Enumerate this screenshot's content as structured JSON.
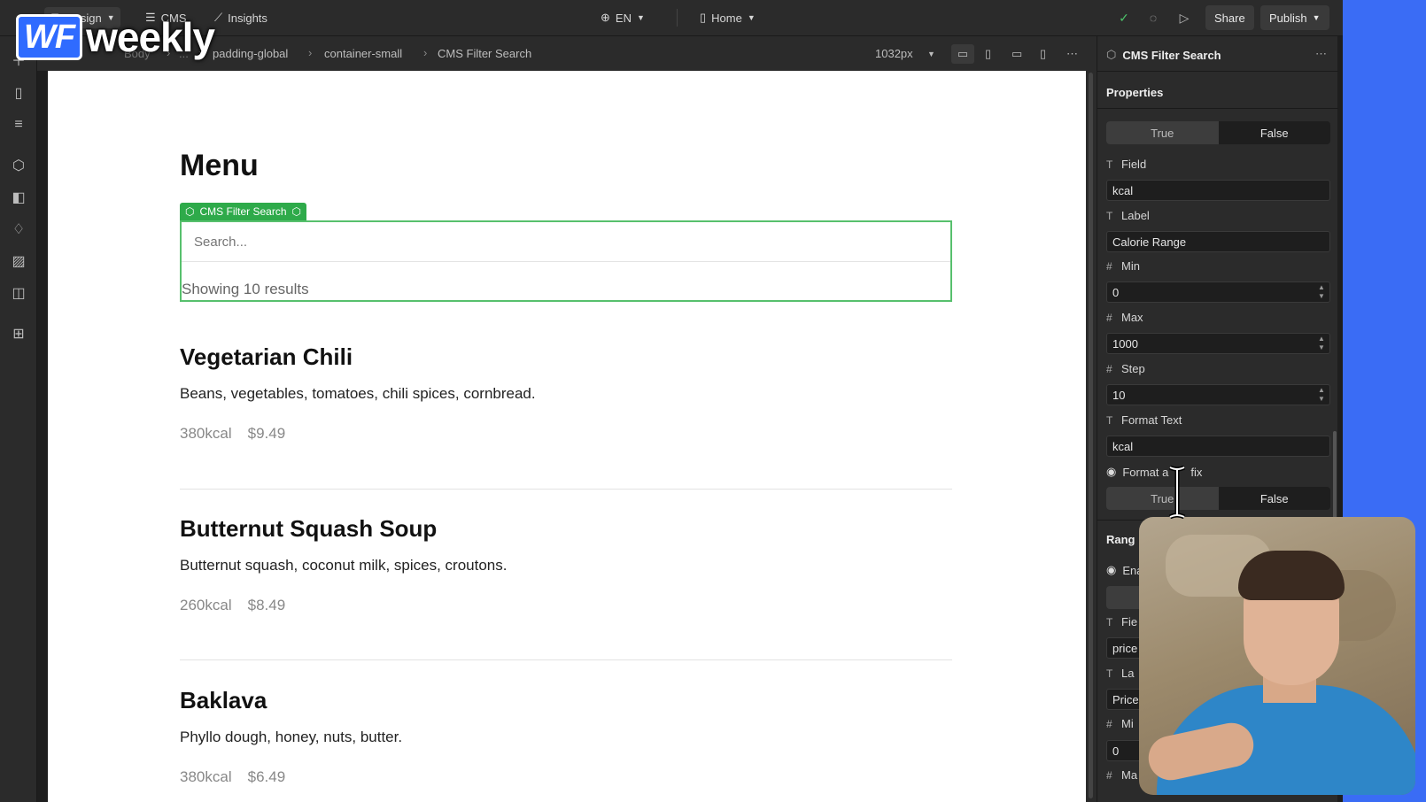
{
  "topbar": {
    "design_label": "Design",
    "cms_label": "CMS",
    "insights_label": "Insights",
    "locale": "EN",
    "page": "Home",
    "share_label": "Share",
    "publish_label": "Publish"
  },
  "logo": {
    "wf": "WF",
    "weekly": "weekly"
  },
  "breadcrumb": {
    "body": "Body",
    "ellipsis": "...",
    "padding": "padding-global",
    "container": "container-small",
    "current": "CMS Filter Search"
  },
  "viewport": {
    "width_label": "1032px"
  },
  "canvas": {
    "title": "Menu",
    "cms_tag": "CMS Filter Search",
    "search_placeholder": "Search...",
    "showing": "Showing 10 results",
    "items": [
      {
        "title": "Vegetarian Chili",
        "desc": "Beans, vegetables, tomatoes, chili spices, cornbread.",
        "kcal": "380kcal",
        "price": "$9.49"
      },
      {
        "title": "Butternut Squash Soup",
        "desc": "Butternut squash, coconut milk, spices, croutons.",
        "kcal": "260kcal",
        "price": "$8.49"
      },
      {
        "title": "Baklava",
        "desc": "Phyllo dough, honey, nuts, butter.",
        "kcal": "380kcal",
        "price": "$6.49"
      }
    ]
  },
  "panel": {
    "component": "CMS Filter Search",
    "properties_label": "Properties",
    "seg1": {
      "true_label": "True",
      "false_label": "False"
    },
    "field_label": "Field",
    "field_value": "kcal",
    "label_label": "Label",
    "label_value": "Calorie Range",
    "min_label": "Min",
    "min_value": "0",
    "max_label": "Max",
    "max_value": "1000",
    "step_label": "Step",
    "step_value": "10",
    "format_text_label": "Format Text",
    "format_text_value": "kcal",
    "format_suffix_label": "Format a",
    "format_suffix_tail": "fix",
    "seg2": {
      "true_label": "True",
      "false_label": "False"
    },
    "range_label": "Rang",
    "enable_label": "Ena",
    "field2_label": "Fie",
    "field2_value": "price",
    "label2_label": "La",
    "label2_value": "Price",
    "min2_label": "Mi",
    "min2_value": "0",
    "max2_label": "Ma"
  },
  "colors": {
    "accent_green": "#2eaa4a",
    "brand_blue": "#3a6cf5",
    "panel_bg": "#2b2b2b"
  }
}
